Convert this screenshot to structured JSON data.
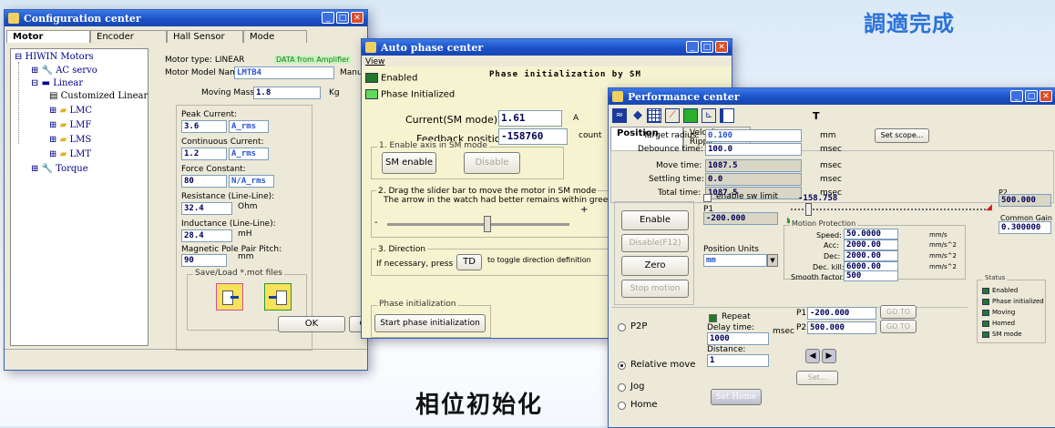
{
  "captions": {
    "top_right": "調適完成",
    "bottom": "相位初始化"
  },
  "config": {
    "title": "Configuration center",
    "tabs": [
      "Motor",
      "Encoder",
      "Hall Sensor",
      "Mode"
    ],
    "tree": {
      "root": "HIWIN Motors",
      "ac_servo": "AC servo",
      "linear": "Linear",
      "customized": "Customized Linear",
      "lmc": "LMC",
      "lmf": "LMF",
      "lms": "LMS",
      "lmt": "LMT",
      "torque": "Torque"
    },
    "motor_type_label": "Motor type: LINEAR",
    "amp_badge": "DATA from Amplifier",
    "model_label": "Motor Model Name:",
    "model_value": "LMTB4",
    "manuf_label": "Manufa",
    "moving_mass_label": "Moving Mass:",
    "moving_mass_value": "1.8",
    "moving_mass_unit": "Kg",
    "peak_current_label": "Peak Current:",
    "peak_current_value": "3.6",
    "peak_current_unit": "A_rms",
    "cont_current_label": "Continuous Current:",
    "cont_current_value": "1.2",
    "cont_current_unit": "A_rms",
    "force_const_label": "Force Constant:",
    "force_const_value": "80",
    "force_const_unit": "N/A_rms",
    "resistance_label": "Resistance (Line-Line):",
    "resistance_value": "32.4",
    "resistance_unit": "Ohm",
    "inductance_label": "Inductance (Line-Line):",
    "inductance_value": "28.4",
    "inductance_unit": "mH",
    "pole_pitch_label": "Magnetic Pole Pair Pitch:",
    "pole_pitch_value": "90",
    "pole_pitch_unit": "mm",
    "save_load_label": "Save/Load *.mot files",
    "ok_label": "OK",
    "cancel_label": "C"
  },
  "auto": {
    "title": "Auto phase center",
    "menu": "View",
    "enabled_label": "Enabled",
    "phase_init_label": "Phase Initialized",
    "header_text": "Phase initialization by SM",
    "current_label": "Current(SM mode):",
    "current_value": "1.61",
    "current_unit": "A",
    "feedback_label": "Feedback position:",
    "feedback_value": "-158760",
    "feedback_unit": "count",
    "sec1_title": "1. Enable axis in SM mode",
    "sm_enable": "SM enable",
    "disable": "Disable",
    "sec2_title": "2. Drag the slider bar to move the motor in SM mode",
    "sec2_sub": "The arrow in the watch had better remains within green range duri",
    "minus": "-",
    "plus": "+",
    "sec3_title": "3. Direction",
    "if_necessary": "If necessary, press",
    "td": "TD",
    "toggle_text": "to toggle direction definition",
    "phase_init_group": "Phase initialization",
    "start_phase": "Start phase initialization"
  },
  "perf": {
    "title": "Performance center",
    "t_label": "T",
    "tabs": [
      "Position",
      "Velocity Ripple"
    ],
    "target_radius_label": "Target radius:",
    "target_radius_value": "0.100",
    "target_radius_unit": "mm",
    "debounce_label": "Debounce time:",
    "debounce_value": "100.0",
    "debounce_unit": "msec",
    "set_scope": "Set scope...",
    "move_time_label": "Move time:",
    "move_time_value": "1087.5",
    "move_time_unit": "msec",
    "settling_label": "Settling time:",
    "settling_value": "0.0",
    "settling_unit": "msec",
    "total_label": "Total time:",
    "total_value": "1087.5",
    "total_unit": "msec",
    "enable_sw_limit": "enable sw limit",
    "p1_label": "P1",
    "p1_value": "-200.000",
    "slider_value": "-158.758",
    "p2_label": "P2",
    "p2_value": "500.000",
    "common_gain_label": "Common Gain",
    "common_gain_value": "0.300000",
    "enable": "Enable",
    "disable_f12": "Disable(F12)",
    "zero": "Zero",
    "stop_motion": "Stop motion",
    "position_units_label": "Position Units",
    "position_units_value": "mm",
    "motion_protection": "Motion Protection",
    "speed_label": "Speed:",
    "speed_value": "50.0000",
    "speed_unit": "mm/s",
    "acc_label": "Acc:",
    "acc_value": "2000.00",
    "acc_unit": "mm/s^2",
    "dec_label": "Dec:",
    "dec_value": "2000.00",
    "dec_unit": "mm/s^2",
    "deckill_label": "Dec. kill:",
    "deckill_value": "6000.00",
    "deckill_unit": "mm/s^2",
    "smooth_label": "Smooth factor:",
    "smooth_value": "500",
    "status_label": "Status",
    "status_items": [
      "Enabled",
      "Phase initialized",
      "Moving",
      "Homed",
      "SM mode"
    ],
    "p2p": "P2P",
    "repeat": "Repeat",
    "delay_label": "Delay time:",
    "delay_value": "1000",
    "delay_unit": "msec",
    "p1_move_label": "P1",
    "p1_move_value": "-200.000",
    "p2_move_label": "P2",
    "p2_move_value": "500.000",
    "goto": "GO TO",
    "relative_move": "Relative move",
    "distance_label": "Distance:",
    "distance_value": "1",
    "jog": "Jog",
    "set": "Set...",
    "home": "Home",
    "home_btn": "Home",
    "home_btn_prefix": "Set"
  },
  "colors": {
    "titlebar": "#1a4fc4",
    "caption": "#2a72d8",
    "window_bg": "#ece9d8"
  }
}
